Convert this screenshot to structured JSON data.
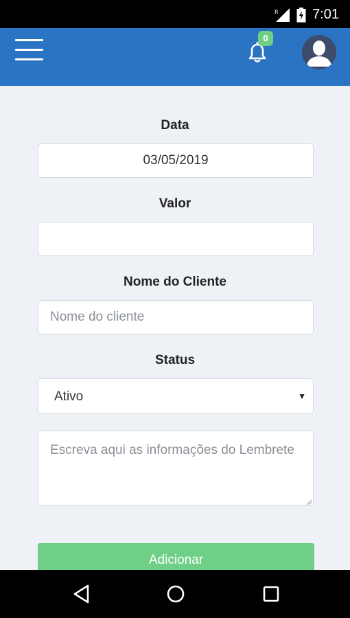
{
  "status_bar": {
    "time": "7:01"
  },
  "app_bar": {
    "notification_count": "0"
  },
  "form": {
    "date_label": "Data",
    "date_value": "03/05/2019",
    "value_label": "Valor",
    "value_value": "",
    "client_label": "Nome do Cliente",
    "client_placeholder": "Nome do cliente",
    "status_label": "Status",
    "status_selected": "Ativo",
    "notes_placeholder": "Escreva aqui as informações do Lembrete",
    "submit_label": "Adicionar"
  },
  "colors": {
    "primary": "#2a74c3",
    "success": "#6fcf86",
    "background": "#eef1f5"
  },
  "icons": [
    "menu-icon",
    "bell-icon",
    "avatar-icon",
    "signal-icon",
    "battery-icon",
    "back-icon",
    "home-icon",
    "recents-icon"
  ]
}
